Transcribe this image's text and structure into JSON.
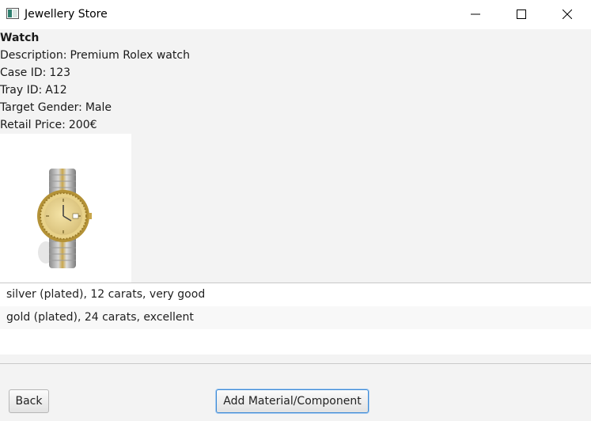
{
  "window": {
    "title": "Jewellery Store",
    "controls": {
      "minimize": "minimize-icon",
      "maximize": "maximize-icon",
      "close": "close-icon"
    }
  },
  "item": {
    "title": "Watch",
    "details": [
      {
        "label": "Description:",
        "value": "Premium Rolex watch"
      },
      {
        "label": "Case ID:",
        "value": "123"
      },
      {
        "label": "Tray ID:",
        "value": "A12"
      },
      {
        "label": "Target Gender:",
        "value": "Male"
      },
      {
        "label": "Retail Price:",
        "value": "200€"
      }
    ],
    "image_icon": "watch-image"
  },
  "materials": [
    "silver (plated), 12 carats, very good",
    "gold (plated), 24 carats, excellent"
  ],
  "buttons": {
    "back": "Back",
    "add_material": "Add Material/Component"
  },
  "colors": {
    "accent_focus": "#3c8ad6",
    "background": "#f3f3f3"
  }
}
